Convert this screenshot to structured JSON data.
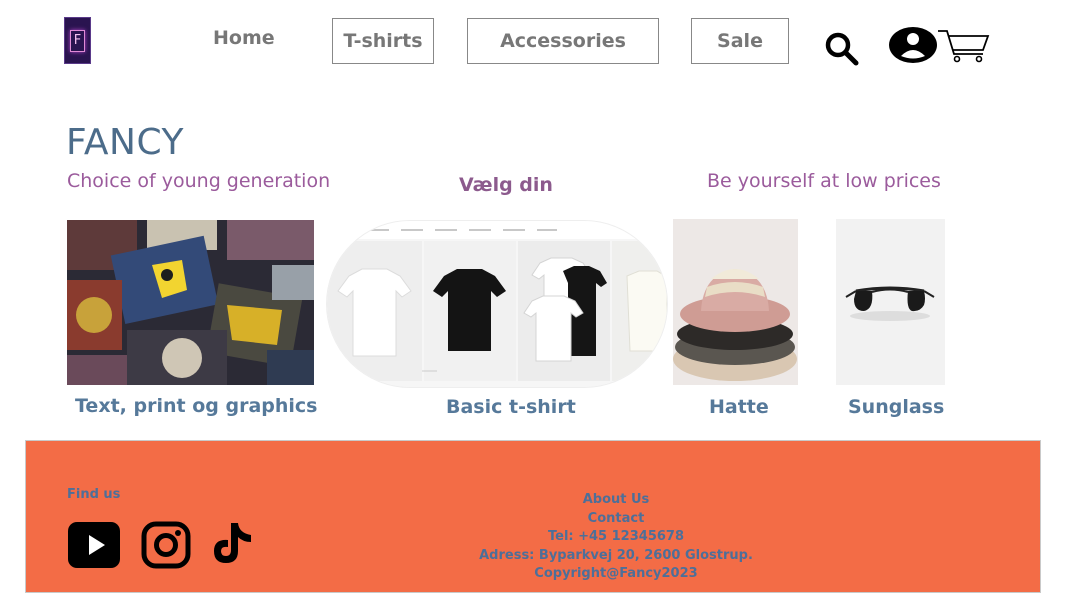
{
  "header": {
    "logo_letter": "F",
    "nav": {
      "home": "Home",
      "tshirts": "T-shirts",
      "accessories": "Accessories",
      "sale": "Sale"
    },
    "icons": [
      "search-icon",
      "user-icon",
      "cart-icon"
    ]
  },
  "hero": {
    "brand": "FANCY",
    "tagline_left": "Choice of young generation",
    "choose_label": "Vælg din",
    "tagline_right": "Be yourself  at low prices"
  },
  "products": [
    {
      "caption": "Text, print og graphics"
    },
    {
      "caption": "Basic t-shirt"
    },
    {
      "caption": "Hatte"
    },
    {
      "caption": "Sunglass"
    }
  ],
  "footer": {
    "find_us": "Find us",
    "social_icons": [
      "youtube-icon",
      "instagram-icon",
      "tiktok-icon"
    ],
    "links": {
      "about": "About Us",
      "contact": "Contact",
      "tel": "Tel: +45 12345678",
      "address": "Adress: Byparkvej 20, 2600 Glostrup.",
      "copyright": "Copyright@Fancy2023"
    }
  },
  "colors": {
    "brand_blue": "#4c6c8a",
    "tagline_purple": "#9b5b9c",
    "footer_bg": "#f36c46",
    "footer_text": "#4d6f99"
  }
}
